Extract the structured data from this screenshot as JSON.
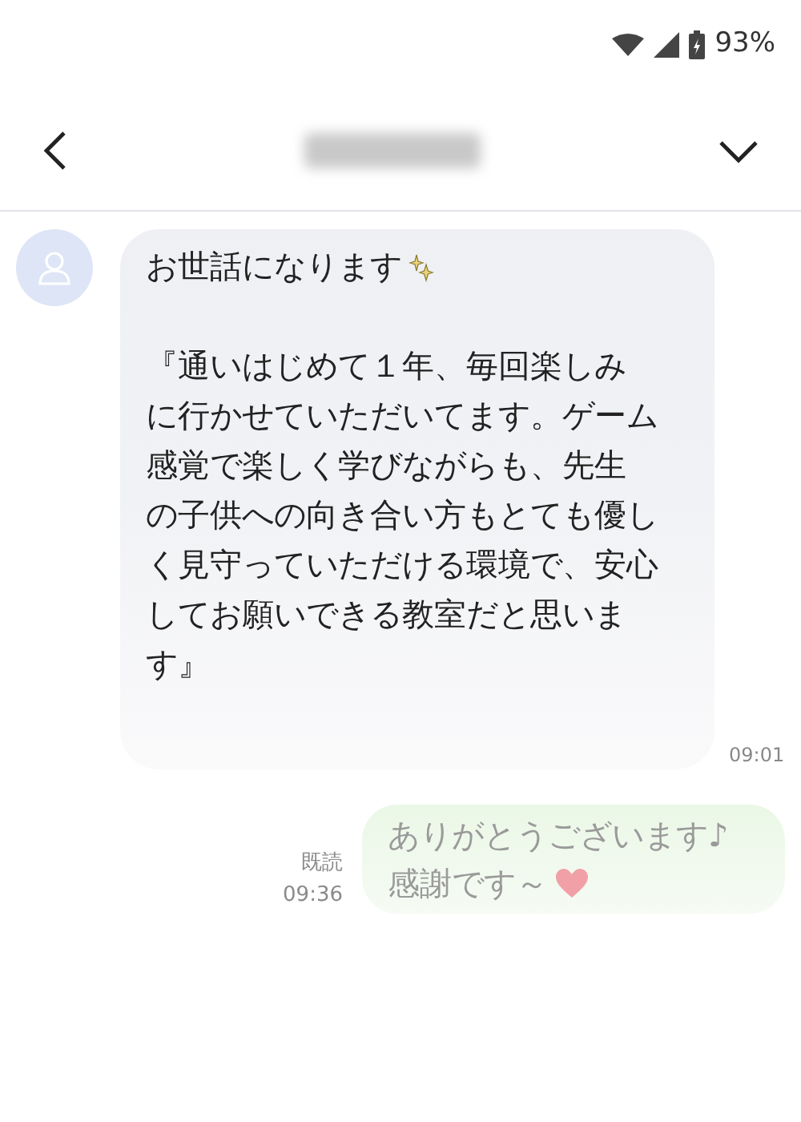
{
  "status_bar": {
    "battery": "93%"
  },
  "messages": [
    {
      "kind": "received",
      "greeting": "お世話になります",
      "lines": [
        "『通いはじめて１年、毎回楽しみ",
        "に行かせていただいてます。ゲーム",
        "感覚で楽しく学びながらも、先生",
        "の子供への向き合い方もとても優し",
        "く見守っていただける環境で、安心",
        "してお願いできる教室だと思いま",
        "す』"
      ],
      "time": "09:01"
    },
    {
      "kind": "sent",
      "lines": [
        "ありがとうございます♪",
        "感謝です～"
      ],
      "read": "既読",
      "time": "09:36"
    }
  ]
}
